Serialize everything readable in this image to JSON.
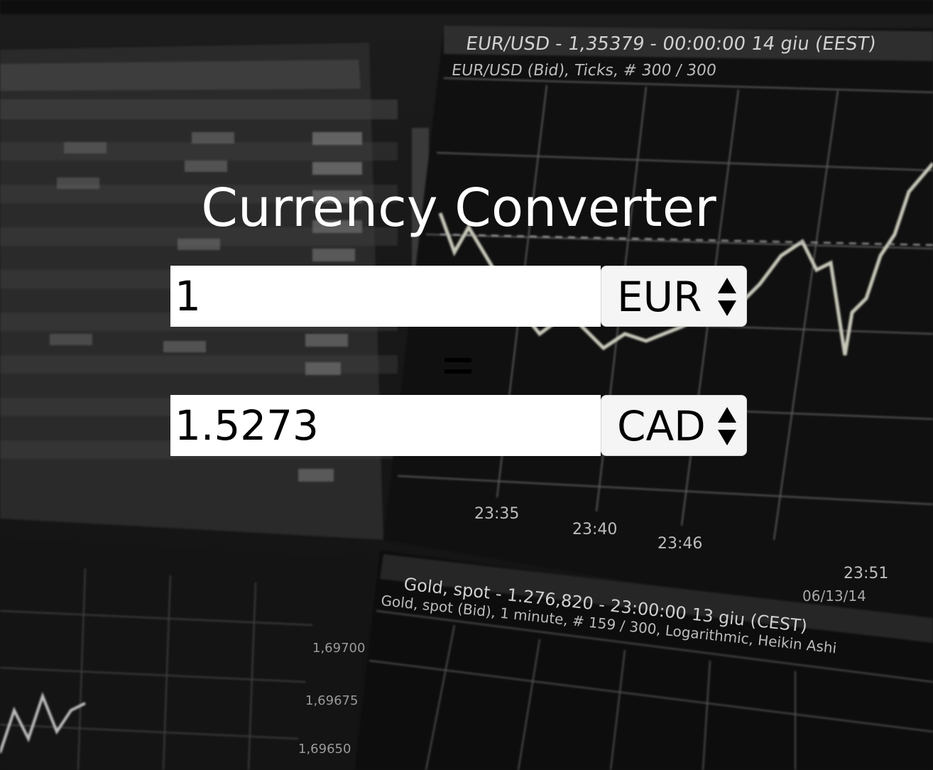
{
  "background": {
    "chart_top_title": "EUR/USD - 1,35379 - 00:00:00  14 giu (EEST)",
    "chart_top_subtitle": "EUR/USD (Bid), Ticks, # 300 / 300",
    "time_labels": [
      "23:35",
      "23:40",
      "23:46",
      "23:51"
    ],
    "date_label": "06/13/14",
    "chart_bottom_title": "Gold, spot - 1.276,820 - 23:00:00  13 giu (CEST)",
    "chart_bottom_subtitle": "Gold, spot (Bid), 1 minute, # 159 / 300, Logarithmic, Heikin Ashi",
    "price_labels": [
      "1,69700",
      "1,69675",
      "1,69650"
    ]
  },
  "app": {
    "title": "Currency Converter",
    "from": {
      "amount": "1",
      "currency": "EUR"
    },
    "equals_sign": "=",
    "to": {
      "amount": "1.5273",
      "currency": "CAD"
    }
  },
  "colors": {
    "title": "#ffffff",
    "input_bg": "#ffffff",
    "select_bg": "#f5f5f5"
  }
}
